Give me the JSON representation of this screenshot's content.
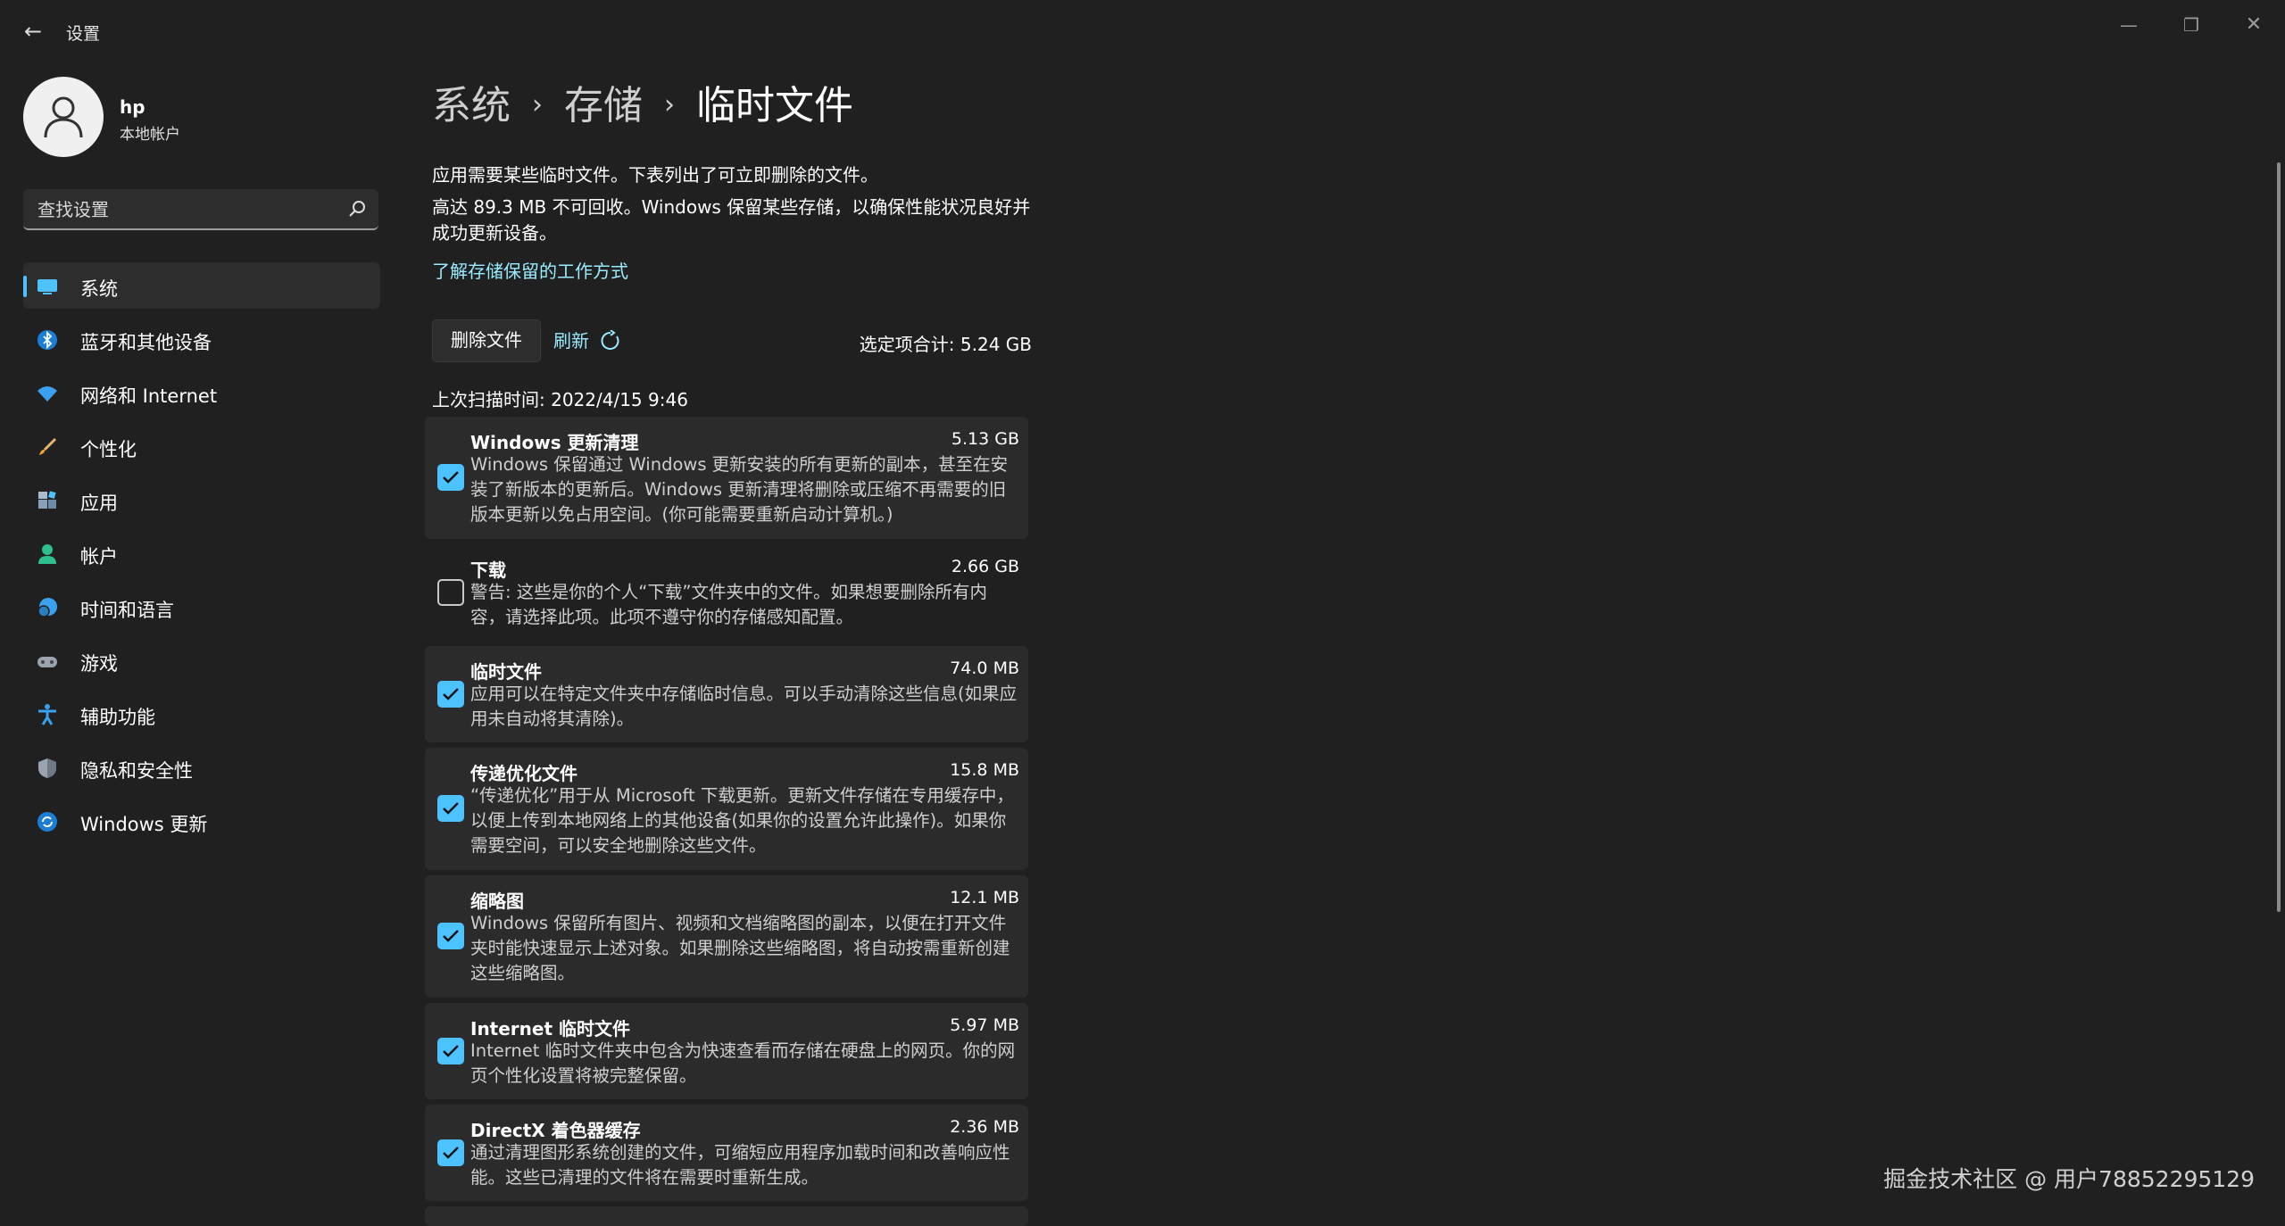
{
  "app": {
    "title": "设置"
  },
  "user": {
    "name": "hp",
    "account_type": "本地帐户"
  },
  "search": {
    "placeholder": "查找设置"
  },
  "nav": {
    "items": [
      {
        "label": "系统",
        "icon": "system-icon",
        "active": true
      },
      {
        "label": "蓝牙和其他设备",
        "icon": "bluetooth-icon"
      },
      {
        "label": "网络和 Internet",
        "icon": "network-icon"
      },
      {
        "label": "个性化",
        "icon": "brush-icon"
      },
      {
        "label": "应用",
        "icon": "apps-icon"
      },
      {
        "label": "帐户",
        "icon": "account-icon"
      },
      {
        "label": "时间和语言",
        "icon": "time-language-icon"
      },
      {
        "label": "游戏",
        "icon": "gamepad-icon"
      },
      {
        "label": "辅助功能",
        "icon": "accessibility-icon"
      },
      {
        "label": "隐私和安全性",
        "icon": "shield-icon"
      },
      {
        "label": "Windows 更新",
        "icon": "windows-update-icon"
      }
    ]
  },
  "breadcrumb": {
    "level1": "系统",
    "level2": "存储",
    "current": "临时文件"
  },
  "main": {
    "intro": "应用需要某些临时文件。下表列出了可立即删除的文件。",
    "reserve_note": "高达 89.3 MB 不可回收。Windows 保留某些存储，以确保性能状况良好并成功更新设备。",
    "learn_link": "了解存储保留的工作方式",
    "delete_button": "删除文件",
    "refresh_label": "刷新",
    "selected_total": "选定项合计: 5.24 GB",
    "last_scan": "上次扫描时间: 2022/4/15 9:46"
  },
  "items": [
    {
      "title": "Windows 更新清理",
      "size": "5.13 GB",
      "checked": true,
      "desc": "Windows 保留通过 Windows 更新安装的所有更新的副本，甚至在安装了新版本的更新后。Windows 更新清理将删除或压缩不再需要的旧版本更新以免占用空间。(你可能需要重新启动计算机。)"
    },
    {
      "title": "下载",
      "size": "2.66 GB",
      "checked": false,
      "desc": "警告: 这些是你的个人“下载”文件夹中的文件。如果想要删除所有内容，请选择此项。此项不遵守你的存储感知配置。"
    },
    {
      "title": "临时文件",
      "size": "74.0 MB",
      "checked": true,
      "desc": "应用可以在特定文件夹中存储临时信息。可以手动清除这些信息(如果应用未自动将其清除)。"
    },
    {
      "title": "传递优化文件",
      "size": "15.8 MB",
      "checked": true,
      "desc": "“传递优化”用于从 Microsoft 下载更新。更新文件存储在专用缓存中，以便上传到本地网络上的其他设备(如果你的设置允许此操作)。如果你需要空间，可以安全地删除这些文件。"
    },
    {
      "title": "缩略图",
      "size": "12.1 MB",
      "checked": true,
      "desc": "Windows 保留所有图片、视频和文档缩略图的副本，以便在打开文件夹时能快速显示上述对象。如果删除这些缩略图，将自动按需重新创建这些缩略图。"
    },
    {
      "title": "Internet 临时文件",
      "size": "5.97 MB",
      "checked": true,
      "desc": "Internet 临时文件夹中包含为快速查看而存储在硬盘上的网页。你的网页个性化设置将被完整保留。"
    },
    {
      "title": "DirectX 着色器缓存",
      "size": "2.36 MB",
      "checked": true,
      "desc": "通过清理图形系统创建的文件，可缩短应用程序加载时间和改善响应性能。这些已清理的文件将在需要时重新生成。"
    }
  ],
  "watermark": "掘金技术社区 @ 用户78852295129",
  "colors": {
    "accent": "#4cc2ff",
    "link": "#99ebff",
    "background": "#202020",
    "card": "#2b2b2b"
  }
}
